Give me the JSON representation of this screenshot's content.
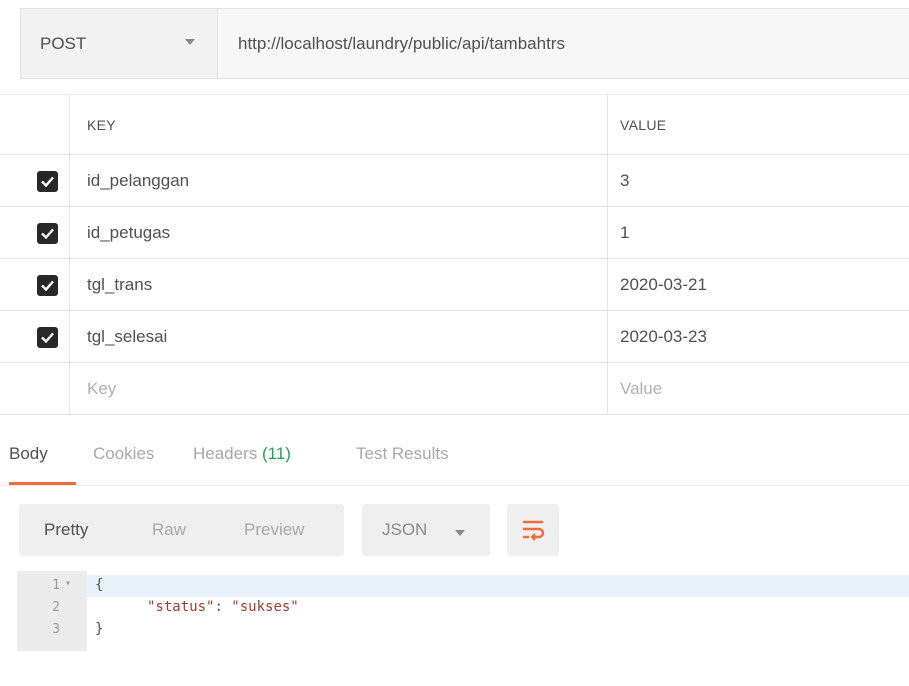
{
  "request": {
    "method": "POST",
    "url": "http://localhost/laundry/public/api/tambahtrs"
  },
  "params": {
    "headers": {
      "key": "KEY",
      "value": "VALUE"
    },
    "rows": [
      {
        "checked": true,
        "key": "id_pelanggan",
        "value": "3"
      },
      {
        "checked": true,
        "key": "id_petugas",
        "value": "1"
      },
      {
        "checked": true,
        "key": "tgl_trans",
        "value": "2020-03-21"
      },
      {
        "checked": true,
        "key": "tgl_selesai",
        "value": "2020-03-23"
      }
    ],
    "placeholder": {
      "key": "Key",
      "value": "Value"
    }
  },
  "response": {
    "tabs": {
      "body": "Body",
      "cookies": "Cookies",
      "headers": "Headers",
      "headers_count": "(11)",
      "tests": "Test Results"
    },
    "active_tab": "Body",
    "formats": {
      "pretty": "Pretty",
      "raw": "Raw",
      "preview": "Preview"
    },
    "active_format": "Pretty",
    "language": "JSON",
    "code": {
      "line_numbers": [
        "1",
        "2",
        "3"
      ],
      "open_brace": "{",
      "key": "\"status\"",
      "colon": ": ",
      "value": "\"sukses\"",
      "close_brace": "}"
    }
  },
  "colors": {
    "accent": "#f26b3a",
    "count_green": "#27a05a",
    "checkbox": "#282828",
    "string_red": "#a23b2f"
  },
  "icons": {
    "method_caret": "chevron-down-icon",
    "checkbox": "checkmark-icon",
    "wrap": "wrap-lines-icon",
    "fold": "fold-arrow-icon"
  }
}
